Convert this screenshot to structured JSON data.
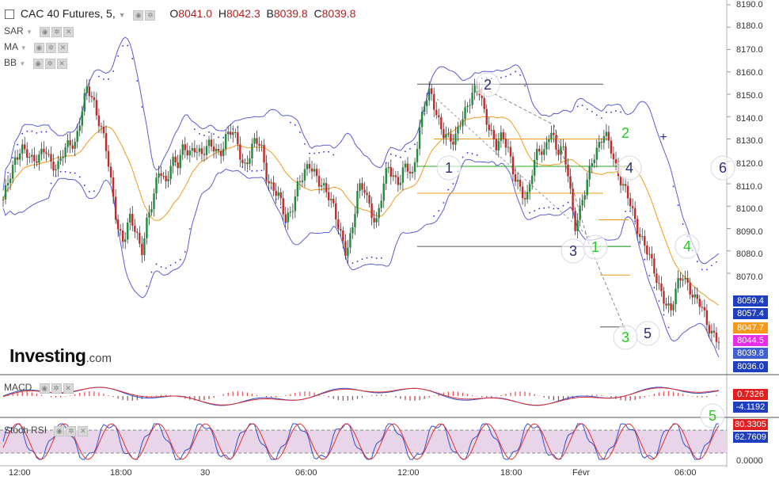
{
  "header": {
    "symbol": "CAC 40 Futures, 5,",
    "open_label": "O",
    "open": "8041.0",
    "high_label": "H",
    "high": "8042.3",
    "low_label": "B",
    "low": "8039.8",
    "close_label": "C",
    "close": "8039.8"
  },
  "indicators": [
    "SAR",
    "MA",
    "BB"
  ],
  "logo": {
    "main": "Investing",
    "suffix": ".com"
  },
  "panels": {
    "macd_label": "MACD",
    "stoch_label": "Stoch RSI"
  },
  "price_axis": {
    "ticks": [
      "8190.0",
      "8180.0",
      "8170.0",
      "8160.0",
      "8150.0",
      "8140.0",
      "8130.0",
      "8120.0",
      "8110.0",
      "8100.0",
      "8090.0",
      "8080.0",
      "8070.0"
    ],
    "tags": [
      {
        "value": "8059.4",
        "color": "#1f3fbf"
      },
      {
        "value": "8057.4",
        "color": "#1f3fbf"
      },
      {
        "value": "8047.7",
        "color": "#f39a1b"
      },
      {
        "value": "8044.5",
        "color": "#e62ee6"
      },
      {
        "value": "8039.8",
        "color": "#4060d0"
      },
      {
        "value": "8036.0",
        "color": "#1f3fbf"
      }
    ]
  },
  "macd_axis": {
    "tags": [
      {
        "value": "0.7326",
        "color": "#e02020"
      },
      {
        "value": "-4.1192",
        "color": "#1f3fbf"
      }
    ]
  },
  "stoch_axis": {
    "tags": [
      {
        "value": "80.3305",
        "color": "#e02020"
      },
      {
        "value": "62.7609",
        "color": "#1f3fbf"
      }
    ],
    "zero": "0.0000"
  },
  "time_axis": [
    "12:00",
    "18:00",
    "30",
    "06:00",
    "12:00",
    "18:00",
    "Févr",
    "06:00"
  ],
  "annotations": {
    "wave_labels": [
      {
        "text": "1",
        "color": "#2b2f7a",
        "circled": true
      },
      {
        "text": "2",
        "color": "#2b2f7a",
        "circled": true
      },
      {
        "text": "3",
        "color": "#2b2f7a",
        "circled": true
      },
      {
        "text": "4",
        "color": "#2b2f7a",
        "circled": true
      },
      {
        "text": "5",
        "color": "#2b2f7a",
        "circled": true
      },
      {
        "text": "6",
        "color": "#2b2f7a",
        "circled": true
      },
      {
        "text": "1",
        "color": "#22cc22",
        "circled": true
      },
      {
        "text": "2",
        "color": "#22cc22",
        "circled": false
      },
      {
        "text": "3",
        "color": "#22cc22",
        "circled": true
      },
      {
        "text": "4",
        "color": "#22cc22",
        "circled": true
      },
      {
        "text": "5",
        "color": "#22cc22",
        "circled": true
      }
    ]
  },
  "chart_data": {
    "type": "candlestick",
    "title": "CAC 40 Futures, 5,",
    "interval": "5",
    "ylim": [
      8063,
      8192
    ],
    "y_ticks": [
      8190,
      8180,
      8170,
      8160,
      8150,
      8140,
      8130,
      8120,
      8110,
      8100,
      8090,
      8080,
      8070
    ],
    "x_ticks": [
      "12:00",
      "18:00",
      "30",
      "06:00",
      "12:00",
      "18:00",
      "Févr",
      "06:00"
    ],
    "last": {
      "open": 8041.0,
      "high": 8042.3,
      "low": 8039.8,
      "close": 8039.8
    },
    "overlays": [
      "SAR",
      "MA",
      "BB"
    ],
    "close_path": [
      8103,
      8111,
      8120,
      8128,
      8124,
      8118,
      8122,
      8128,
      8119,
      8115,
      8124,
      8130,
      8128,
      8140,
      8153,
      8148,
      8138,
      8127,
      8108,
      8092,
      8085,
      8094,
      8088,
      8080,
      8096,
      8103,
      8116,
      8110,
      8122,
      8118,
      8125,
      8124,
      8128,
      8122,
      8126,
      8127,
      8124,
      8130,
      8133,
      8128,
      8118,
      8123,
      8129,
      8125,
      8112,
      8108,
      8102,
      8093,
      8100,
      8110,
      8113,
      8118,
      8115,
      8110,
      8104,
      8098,
      8090,
      8080,
      8087,
      8107,
      8110,
      8100,
      8090,
      8105,
      8120,
      8113,
      8110,
      8118,
      8113,
      8132,
      8145,
      8150,
      8142,
      8135,
      8130,
      8127,
      8138,
      8145,
      8150,
      8152,
      8142,
      8135,
      8127,
      8130,
      8125,
      8115,
      8108,
      8100,
      8116,
      8128,
      8124,
      8133,
      8124,
      8128,
      8115,
      8088,
      8098,
      8112,
      8122,
      8125,
      8132,
      8128,
      8117,
      8108,
      8103,
      8095,
      8087,
      8080,
      8072,
      8065,
      8059,
      8052,
      8063,
      8070,
      8065,
      8058,
      8055,
      8048,
      8044,
      8040
    ],
    "horizontal_levels": [
      {
        "price": 8154.5,
        "color": "#555555"
      },
      {
        "price": 8130.0,
        "color": "#f39a1b"
      },
      {
        "price": 8117.8,
        "color": "#22aa22"
      },
      {
        "price": 8105.8,
        "color": "#f39a1b"
      },
      {
        "price": 8093.9,
        "color": "#f39a1b"
      },
      {
        "price": 8082.0,
        "color": "#555555"
      },
      {
        "price": 8082.0,
        "color": "#22aa22"
      },
      {
        "price": 8069.2,
        "color": "#f39a1b"
      },
      {
        "price": 8046.0,
        "color": "#555555"
      }
    ],
    "macd": {
      "signal": 0.7326,
      "macd": -4.1192
    },
    "stoch_rsi": {
      "k": 80.3305,
      "d": 62.7609,
      "bounds": [
        20,
        80
      ],
      "zero": 0.0
    }
  }
}
